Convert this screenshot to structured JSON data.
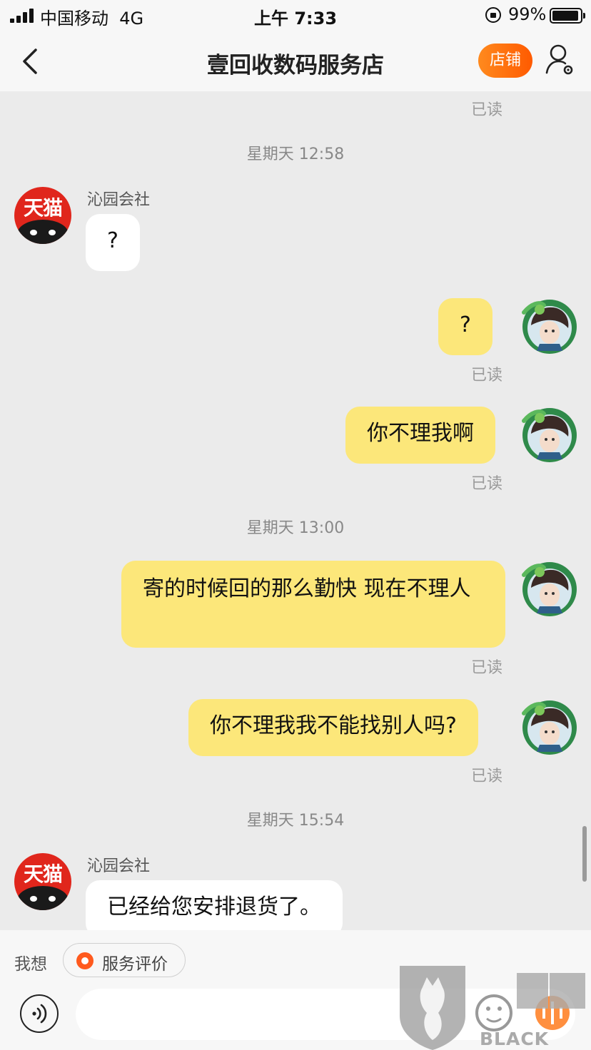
{
  "status_bar": {
    "carrier": "中国移动",
    "network": "4G",
    "time": "上午 7:33",
    "battery": "99%"
  },
  "nav": {
    "title": "壹回收数码服务店",
    "store_label": "店铺"
  },
  "avatar_left_label": "天猫",
  "messages": {
    "read_top": "已读",
    "ts1": "星期天 12:58",
    "m1": {
      "sender": "沁园会社",
      "text": "?"
    },
    "m2": {
      "text": "?",
      "read": "已读"
    },
    "m3": {
      "text": "你不理我啊",
      "read": "已读"
    },
    "ts2": "星期天 13:00",
    "m4": {
      "text": "寄的时候回的那么勤快 现在不理人",
      "read": "已读"
    },
    "m5": {
      "text": "你不理我我不能找别人吗?",
      "read": "已读"
    },
    "ts3": "星期天 15:54",
    "m6": {
      "sender": "沁园会社",
      "text": "已经给您安排退货了。"
    }
  },
  "bottom": {
    "want_label": "我想",
    "chip_label": "服务评价",
    "input_value": "",
    "input_placeholder": ""
  },
  "watermark": {
    "text": "BLACK CAT",
    "brand": "黑猫"
  },
  "colors": {
    "bubble_self": "#fce77a",
    "bubble_other": "#ffffff",
    "store_button": "#ff6a00",
    "background": "#ebebeb"
  }
}
